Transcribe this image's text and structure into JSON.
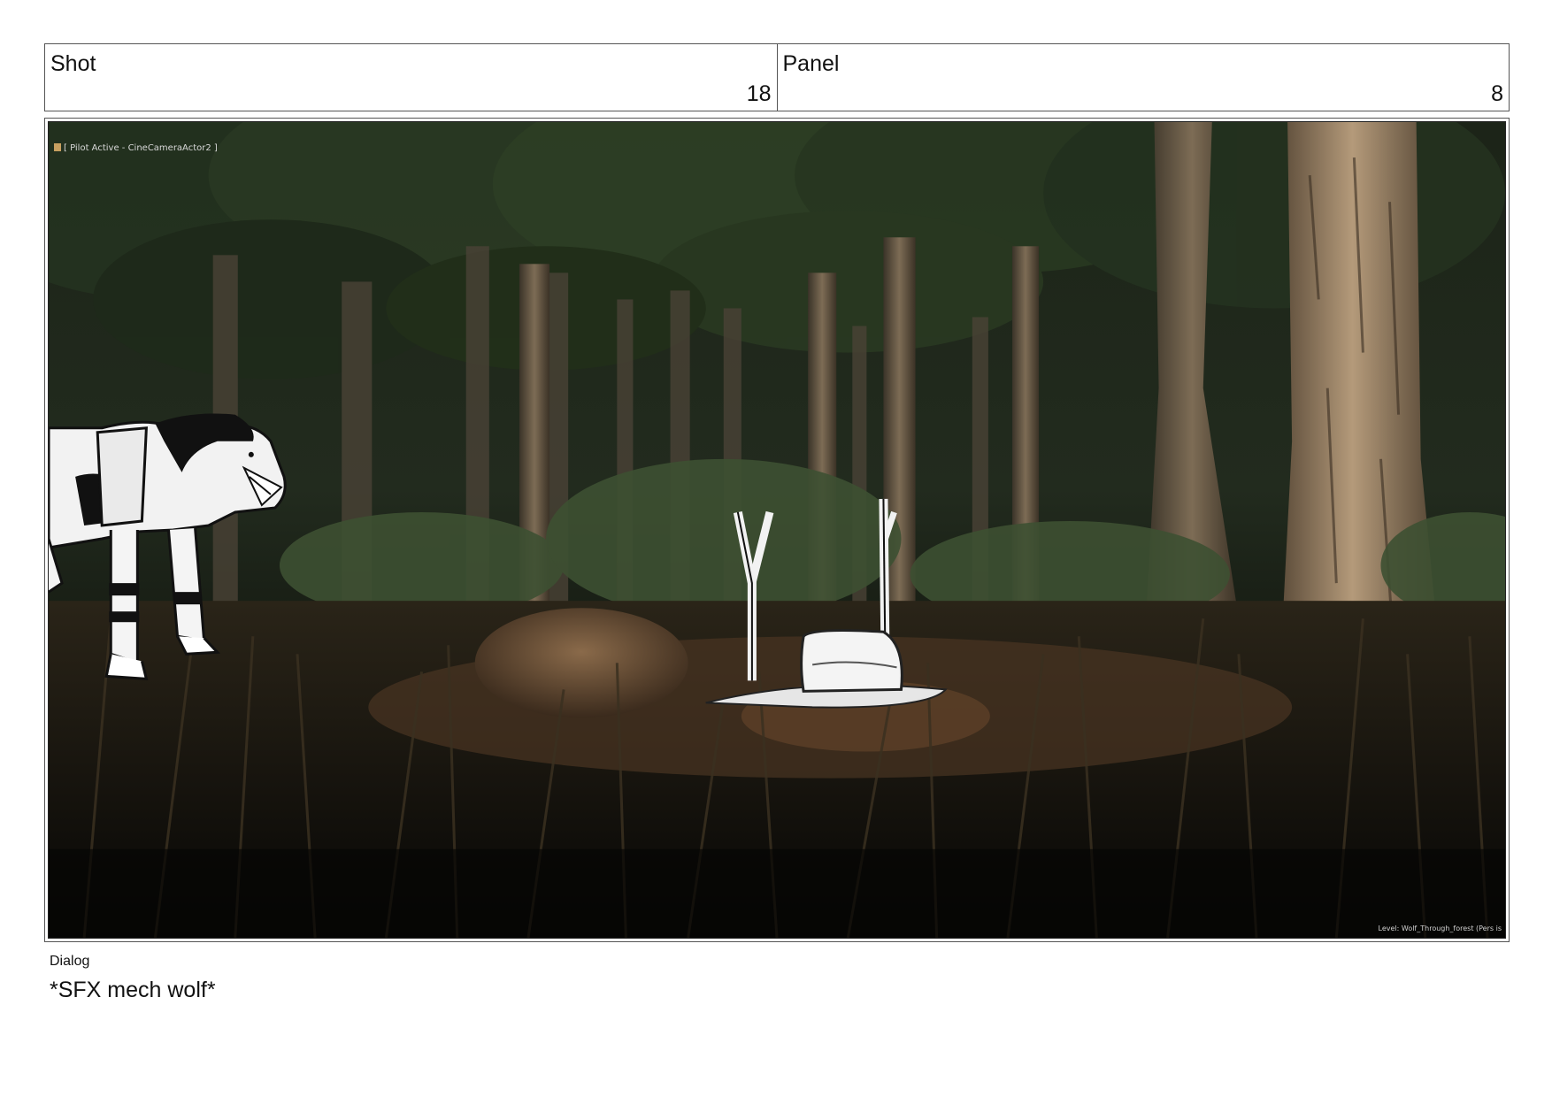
{
  "header": {
    "shot_label": "Shot",
    "shot_value": "18",
    "panel_label": "Panel",
    "panel_value": "8"
  },
  "frame": {
    "hud_top": "[ Pilot Active - CineCameraActor2 ]",
    "hud_bottom": "Level:  Wolf_Through_forest (Pers is"
  },
  "dialog": {
    "label": "Dialog",
    "text": "*SFX mech wolf*"
  }
}
